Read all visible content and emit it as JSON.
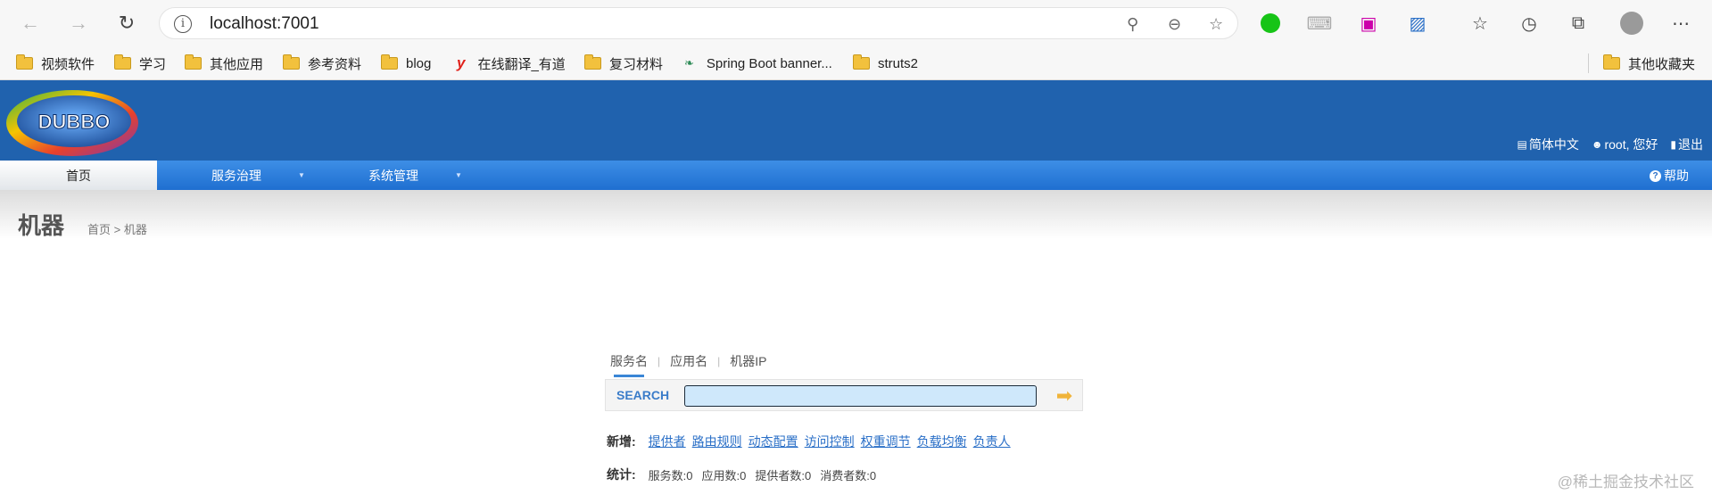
{
  "browser": {
    "url": "localhost:7001",
    "bookmarks": [
      {
        "label": "视频软件",
        "icon": "folder-icon"
      },
      {
        "label": "学习",
        "icon": "folder-icon"
      },
      {
        "label": "其他应用",
        "icon": "folder-icon"
      },
      {
        "label": "参考资料",
        "icon": "folder-icon"
      },
      {
        "label": "blog",
        "icon": "folder-icon"
      },
      {
        "label": "在线翻译_有道",
        "icon": "youdao-icon"
      },
      {
        "label": "复习材料",
        "icon": "folder-icon"
      },
      {
        "label": "Spring Boot banner...",
        "icon": "spring-leaf-icon"
      },
      {
        "label": "struts2",
        "icon": "folder-icon"
      }
    ],
    "other_bookmarks": "其他收藏夹"
  },
  "app": {
    "logo_text": "DUBBO",
    "header_links": {
      "language": "简体中文",
      "user": "root, 您好",
      "logout": "退出"
    },
    "menu": {
      "home": "首页",
      "service_governance": "服务治理",
      "system_management": "系统管理",
      "help": "帮助"
    },
    "page_title": "机器",
    "breadcrumb": "首页 > 机器",
    "search": {
      "tabs": [
        "服务名",
        "应用名",
        "机器IP"
      ],
      "active_tab": 0,
      "label": "SEARCH",
      "value": ""
    },
    "add": {
      "label": "新增:",
      "links": [
        "提供者",
        "路由规则",
        "动态配置",
        "访问控制",
        "权重调节",
        "负载均衡",
        "负责人"
      ]
    },
    "stats": {
      "label": "统计:",
      "items": [
        "服务数:0",
        "应用数:0",
        "提供者数:0",
        "消费者数:0"
      ]
    }
  },
  "watermark": "@稀土掘金技术社区",
  "colors": {
    "header_bg": "#2062ae",
    "menu_bg": "#2a7bdc",
    "link": "#2a6fc7",
    "search_input_bg": "#cfe8fb"
  }
}
